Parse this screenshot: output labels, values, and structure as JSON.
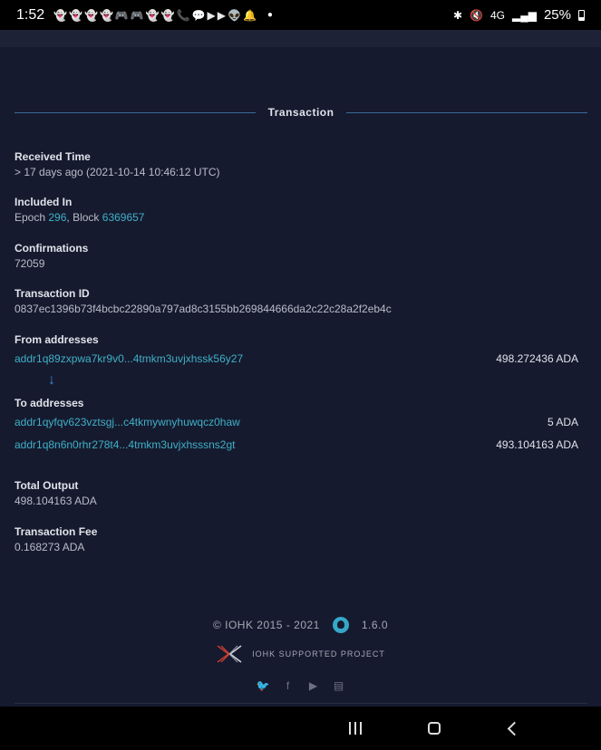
{
  "status_bar": {
    "time": "1:52",
    "notification_icons": [
      "snapchat-icon",
      "snapchat-icon",
      "snapchat-icon",
      "snapchat-icon",
      "game-icon",
      "game-icon",
      "snapchat-icon",
      "snapchat-icon",
      "phone-icon",
      "messenger-icon",
      "youtube-icon",
      "youtube-icon",
      "reddit-icon",
      "bell-icon"
    ],
    "network": "4G",
    "battery": "25%"
  },
  "transaction": {
    "title": "Transaction",
    "received_time": {
      "label": "Received Time",
      "value": "> 17 days ago (2021-10-14 10:46:12 UTC)"
    },
    "included_in": {
      "label": "Included In",
      "epoch_prefix": "Epoch",
      "epoch": "296",
      "block_prefix": ", Block",
      "block": "6369657"
    },
    "confirmations": {
      "label": "Confirmations",
      "value": "72059"
    },
    "transaction_id": {
      "label": "Transaction ID",
      "value": "0837ec1396b73f4bcbc22890a797ad8c3155bb269844666da2c22c28a2f2eb4c"
    },
    "from_addresses": {
      "label": "From addresses",
      "items": [
        {
          "address": "addr1q89zxpwa7kr9v0...4tmkm3uvjxhssk56y27",
          "amount": "498.272436 ADA"
        }
      ]
    },
    "to_addresses": {
      "label": "To addresses",
      "items": [
        {
          "address": "addr1qyfqv623vztsgj...c4tkmywnyhuwqcz0haw",
          "amount": "5 ADA"
        },
        {
          "address": "addr1q8n6n0rhr278t4...4tmkm3uvjxhsssns2gt",
          "amount": "493.104163 ADA"
        }
      ]
    },
    "total_output": {
      "label": "Total Output",
      "value": "498.104163 ADA"
    },
    "transaction_fee": {
      "label": "Transaction Fee",
      "value": "0.168273 ADA"
    }
  },
  "footer": {
    "copyright": "© IOHK 2015 - 2021",
    "version": "1.6.0",
    "supported": "IOHK SUPPORTED PROJECT",
    "socials": [
      "twitter-icon",
      "facebook-icon",
      "youtube-icon",
      "newspaper-icon"
    ]
  },
  "colors": {
    "background": "#161a2e",
    "link": "#3fb0c8",
    "accent_line": "#3a6b9a"
  }
}
